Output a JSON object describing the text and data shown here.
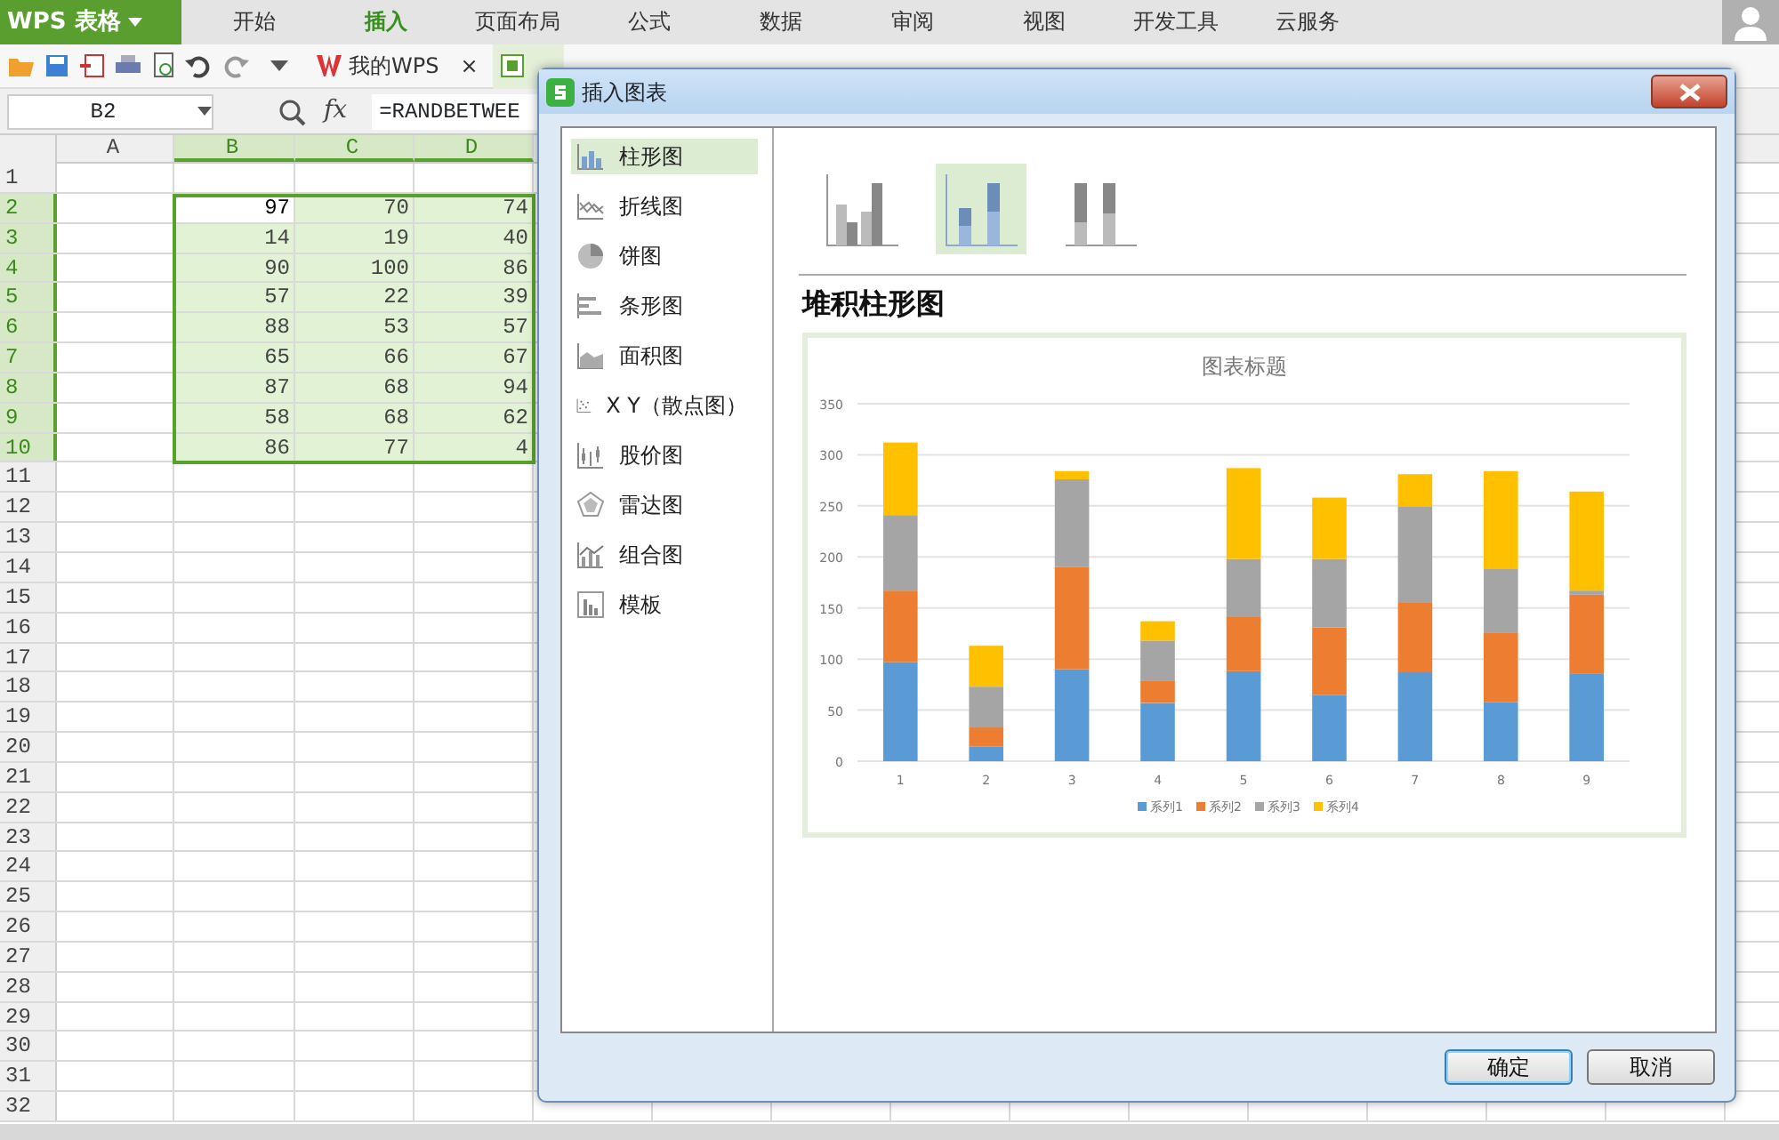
{
  "app": {
    "title": "WPS 表格"
  },
  "ribbon_tabs": [
    {
      "label": "开始",
      "selected": false
    },
    {
      "label": "插入",
      "selected": true
    },
    {
      "label": "页面布局",
      "selected": false
    },
    {
      "label": "公式",
      "selected": false
    },
    {
      "label": "数据",
      "selected": false
    },
    {
      "label": "审阅",
      "selected": false
    },
    {
      "label": "视图",
      "selected": false
    },
    {
      "label": "开发工具",
      "selected": false
    },
    {
      "label": "云服务",
      "selected": false
    }
  ],
  "doc_tabs": [
    {
      "label": "我的WPS",
      "close": "×"
    }
  ],
  "name_box": "B2",
  "formula_label": "fx",
  "formula": "=RANDBETWEE",
  "sheet": {
    "columns": [
      {
        "label": "A",
        "selected": false
      },
      {
        "label": "B",
        "selected": true
      },
      {
        "label": "C",
        "selected": true
      },
      {
        "label": "D",
        "selected": true
      }
    ],
    "rows": [
      {
        "label": "1",
        "selected": false
      },
      {
        "label": "2",
        "selected": true,
        "cells": [
          {
            "value": "97",
            "active": true
          },
          {
            "value": "70",
            "active": false
          },
          {
            "value": "74",
            "active": false
          }
        ]
      },
      {
        "label": "3",
        "selected": true,
        "cells": [
          {
            "value": "14",
            "active": false
          },
          {
            "value": "19",
            "active": false
          },
          {
            "value": "40",
            "active": false
          }
        ]
      },
      {
        "label": "4",
        "selected": true,
        "cells": [
          {
            "value": "90",
            "active": false
          },
          {
            "value": "100",
            "active": false
          },
          {
            "value": "86",
            "active": false
          }
        ]
      },
      {
        "label": "5",
        "selected": true,
        "cells": [
          {
            "value": "57",
            "active": false
          },
          {
            "value": "22",
            "active": false
          },
          {
            "value": "39",
            "active": false
          }
        ]
      },
      {
        "label": "6",
        "selected": true,
        "cells": [
          {
            "value": "88",
            "active": false
          },
          {
            "value": "53",
            "active": false
          },
          {
            "value": "57",
            "active": false
          }
        ]
      },
      {
        "label": "7",
        "selected": true,
        "cells": [
          {
            "value": "65",
            "active": false
          },
          {
            "value": "66",
            "active": false
          },
          {
            "value": "67",
            "active": false
          }
        ]
      },
      {
        "label": "8",
        "selected": true,
        "cells": [
          {
            "value": "87",
            "active": false
          },
          {
            "value": "68",
            "active": false
          },
          {
            "value": "94",
            "active": false
          }
        ]
      },
      {
        "label": "9",
        "selected": true,
        "cells": [
          {
            "value": "58",
            "active": false
          },
          {
            "value": "68",
            "active": false
          },
          {
            "value": "62",
            "active": false
          }
        ]
      },
      {
        "label": "10",
        "selected": true,
        "cells": [
          {
            "value": "86",
            "active": false
          },
          {
            "value": "77",
            "active": false
          },
          {
            "value": "4",
            "active": false
          }
        ]
      },
      {
        "label": "11",
        "selected": false
      },
      {
        "label": "12",
        "selected": false
      },
      {
        "label": "13",
        "selected": false
      },
      {
        "label": "14",
        "selected": false
      },
      {
        "label": "15",
        "selected": false
      },
      {
        "label": "16",
        "selected": false
      },
      {
        "label": "17",
        "selected": false
      },
      {
        "label": "18",
        "selected": false
      },
      {
        "label": "19",
        "selected": false
      },
      {
        "label": "20",
        "selected": false
      },
      {
        "label": "21",
        "selected": false
      },
      {
        "label": "22",
        "selected": false
      },
      {
        "label": "23",
        "selected": false
      },
      {
        "label": "24",
        "selected": false
      },
      {
        "label": "25",
        "selected": false
      },
      {
        "label": "26",
        "selected": false
      },
      {
        "label": "27",
        "selected": false
      },
      {
        "label": "28",
        "selected": false
      },
      {
        "label": "29",
        "selected": false
      },
      {
        "label": "30",
        "selected": false
      },
      {
        "label": "31",
        "selected": false
      },
      {
        "label": "32",
        "selected": false
      }
    ]
  },
  "dialog": {
    "title": "插入图表",
    "categories": [
      {
        "label": "柱形图",
        "kind": "column",
        "selected": true
      },
      {
        "label": "折线图",
        "kind": "line",
        "selected": false
      },
      {
        "label": "饼图",
        "kind": "pie",
        "selected": false
      },
      {
        "label": "条形图",
        "kind": "bar",
        "selected": false
      },
      {
        "label": "面积图",
        "kind": "area",
        "selected": false
      },
      {
        "label": "X Y（散点图）",
        "kind": "scatter",
        "selected": false
      },
      {
        "label": "股价图",
        "kind": "stock",
        "selected": false
      },
      {
        "label": "雷达图",
        "kind": "radar",
        "selected": false
      },
      {
        "label": "组合图",
        "kind": "combo",
        "selected": false
      },
      {
        "label": "模板",
        "kind": "template",
        "selected": false
      }
    ],
    "subtypes": [
      {
        "kind": "clustered",
        "selected": false
      },
      {
        "kind": "stacked",
        "selected": true
      },
      {
        "kind": "percent",
        "selected": false
      }
    ],
    "heading": "堆积柱形图",
    "chart_data": {
      "type": "bar",
      "stacked": true,
      "grid": true,
      "legend": true,
      "title": "图表标题",
      "categories": [
        "1",
        "2",
        "3",
        "4",
        "5",
        "6",
        "7",
        "8",
        "9"
      ],
      "yticks": [
        0,
        50,
        100,
        150,
        200,
        250,
        300,
        350
      ],
      "ylim": [
        0,
        350
      ],
      "series": [
        {
          "name": "系列1",
          "color": "#5b9bd5",
          "values": [
            97,
            14,
            90,
            57,
            88,
            65,
            87,
            58,
            86
          ]
        },
        {
          "name": "系列2",
          "color": "#ed7d31",
          "values": [
            70,
            19,
            100,
            22,
            53,
            66,
            68,
            68,
            77
          ]
        },
        {
          "name": "系列3",
          "color": "#a5a5a5",
          "values": [
            74,
            40,
            86,
            39,
            57,
            67,
            94,
            62,
            4
          ]
        },
        {
          "name": "系列4",
          "color": "#ffc000",
          "values": [
            71,
            40,
            8,
            19,
            89,
            60,
            32,
            96,
            97
          ]
        }
      ]
    },
    "buttons": [
      {
        "label": "确定",
        "default": true
      },
      {
        "label": "取消",
        "default": false
      }
    ]
  }
}
